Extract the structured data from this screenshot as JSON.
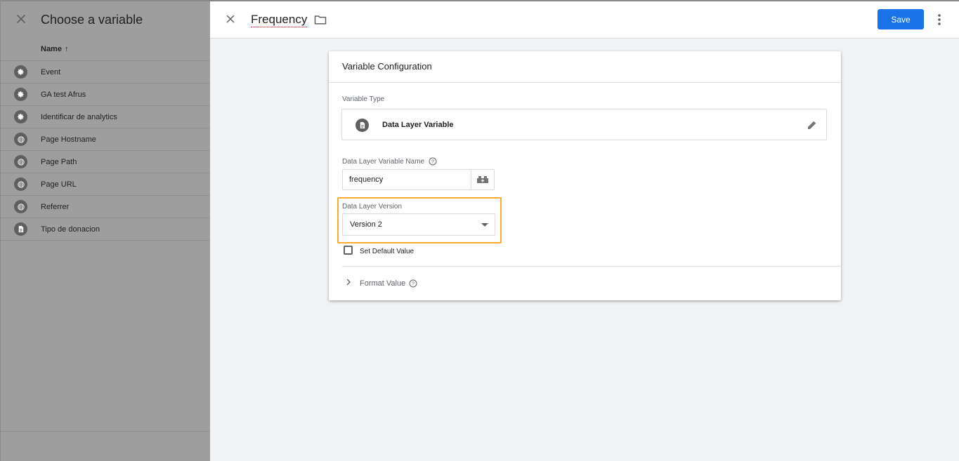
{
  "left_panel": {
    "title": "Choose a variable",
    "column_header": "Name",
    "sort_arrow": "↑",
    "variables": [
      {
        "label": "Event",
        "icon": "gear-icon"
      },
      {
        "label": "GA test Afrus",
        "icon": "gear-icon"
      },
      {
        "label": "Identificar de analytics",
        "icon": "gear-icon"
      },
      {
        "label": "Page Hostname",
        "icon": "globe-icon"
      },
      {
        "label": "Page Path",
        "icon": "globe-icon"
      },
      {
        "label": "Page URL",
        "icon": "globe-icon"
      },
      {
        "label": "Referrer",
        "icon": "globe-icon"
      },
      {
        "label": "Tipo de donacion",
        "icon": "document-icon"
      }
    ]
  },
  "header": {
    "variable_name": "Frequency",
    "save_label": "Save"
  },
  "card": {
    "title": "Variable Configuration",
    "variable_type_label": "Variable Type",
    "variable_type_name": "Data Layer Variable",
    "dl_name_label": "Data Layer Variable Name",
    "dl_name_value": "frequency",
    "dl_version_label": "Data Layer Version",
    "dl_version_value": "Version 2",
    "default_value_label": "Set Default Value",
    "format_value_label": "Format Value"
  },
  "colors": {
    "accent": "#1a73e8",
    "highlight": "#f9ab32",
    "overlay": "#9e9e9e"
  }
}
